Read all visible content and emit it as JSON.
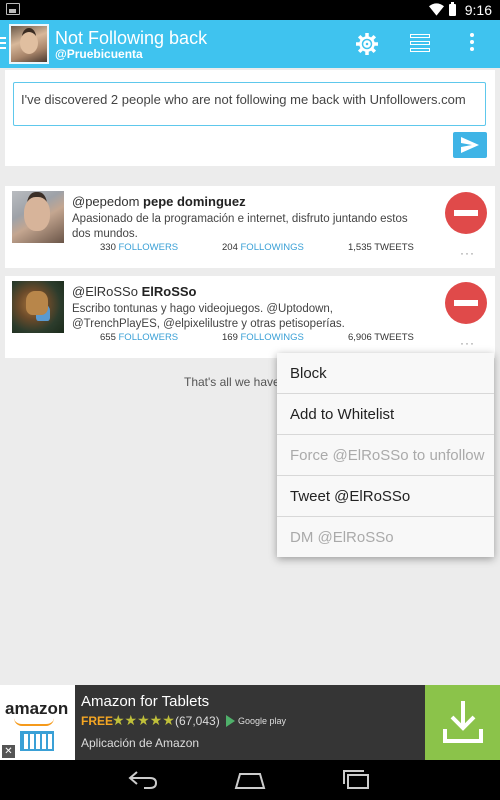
{
  "status_bar": {
    "time": "9:16"
  },
  "action_bar": {
    "title": "Not Following back",
    "account": "@Pruebicuenta",
    "icons": [
      "settings-gear-icon",
      "list-icon",
      "overflow-menu-icon"
    ]
  },
  "compose": {
    "text": "I've discovered 2 people who are not following me back with Unfollowers.com",
    "send_icon": "send-icon"
  },
  "users": [
    {
      "handle": "@pepedom",
      "name": "pepe dominguez",
      "bio": "Apasionado de la programación e internet, disfruto juntando estos dos mundos.",
      "followers": "330",
      "followings": "204",
      "tweets": "1,535"
    },
    {
      "handle": "@ElRoSSo",
      "name": "ElRoSSo",
      "bio": "Escribo tontunas y hago videojuegos. @Uptodown, @TrenchPlayES, @elpixelilustre y otras petisoperías.",
      "followers": "655",
      "followings": "169",
      "tweets": "6,906"
    }
  ],
  "labels": {
    "followers": "FOLLOWERS",
    "followings": "FOLLOWINGS",
    "tweets": "TWEETS",
    "overflow": "···"
  },
  "end_text": "That's all we have",
  "popup_menu": {
    "items": [
      {
        "label": "Block",
        "enabled": true
      },
      {
        "label": "Add to Whitelist",
        "enabled": true
      },
      {
        "label": "Force @ElRoSSo to unfollow",
        "enabled": false
      },
      {
        "label": "Tweet @ElRoSSo",
        "enabled": true
      },
      {
        "label": "DM @ElRoSSo",
        "enabled": false
      }
    ]
  },
  "ad": {
    "logo_text": "amazon",
    "title": "Amazon for Tablets",
    "price": "FREE",
    "stars": "★★★★★",
    "rating_count": "(67,043)",
    "store": "Google play",
    "subtitle": "Aplicación de Amazon",
    "close": "✕"
  },
  "colors": {
    "action_bar": "#3fc3ef",
    "link": "#3aa0d6",
    "unfollow": "#e04a4a",
    "download": "#8bc34a"
  }
}
